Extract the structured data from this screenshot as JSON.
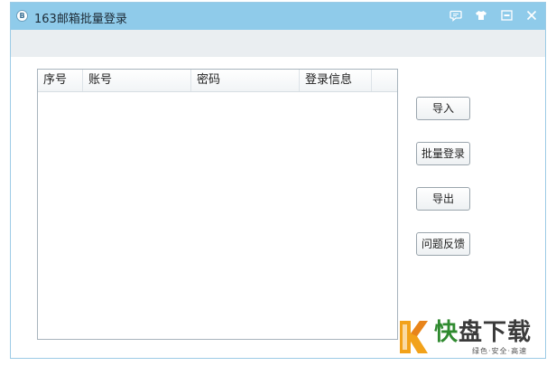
{
  "window": {
    "title": "163邮箱批量登录",
    "app_icon_glyph": "B"
  },
  "titlebar_icons": [
    "chat-bubble-icon",
    "tshirt-skin-icon",
    "minimize-icon",
    "close-icon"
  ],
  "table": {
    "columns": [
      "序号",
      "账号",
      "密码",
      "登录信息"
    ],
    "rows": []
  },
  "buttons": {
    "import": "导入",
    "batch_login": "批量登录",
    "export": "导出",
    "feedback": "问题反馈"
  },
  "watermark": {
    "brand_first": "快",
    "brand_rest": "盘下载",
    "tagline": "绿色·安全·高速",
    "brand_color": "#2f8a2f"
  }
}
